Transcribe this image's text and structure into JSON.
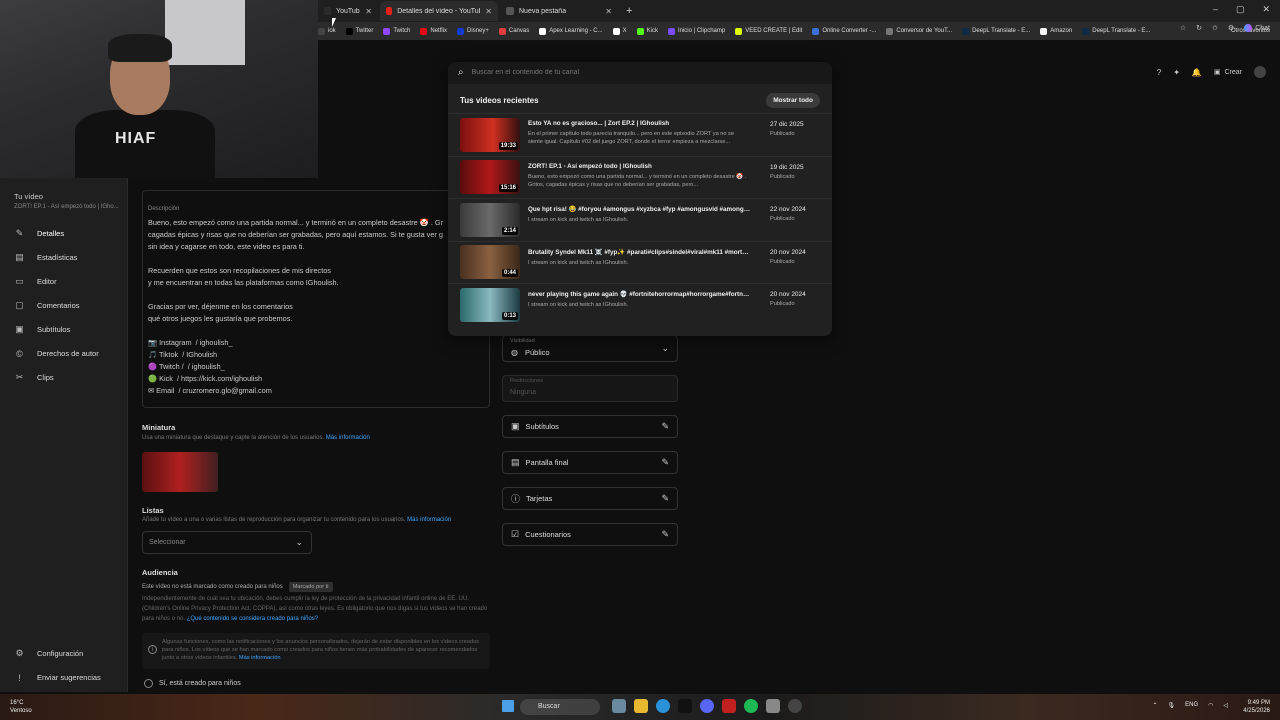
{
  "browser": {
    "tabs": [
      {
        "label": "YouTube",
        "favicon_color": "#2b2b2b"
      },
      {
        "label": "Detalles del vídeo - YouTube Studi",
        "favicon_color": "#e62117"
      },
      {
        "label": "Nueva pestaña",
        "favicon_color": "#555555"
      }
    ],
    "bookmarks": [
      "iok",
      "Twitter",
      "Twitch",
      "Netflix",
      "Disney+",
      "Canvas",
      "Apex Learning - C...",
      "X",
      "Kick",
      "Inicio | Clipchamp",
      "VEED CREATE | Edit",
      "Online Converter -...",
      "Conversor de YouT...",
      "DeepL Translate - E...",
      "Amazon",
      "DeepL Translate - E..."
    ],
    "other_bookmarks": "Otros favoritos",
    "chat_label": "Chat"
  },
  "webcam": {
    "shirt_text": "HIAF"
  },
  "topbar": {
    "create_label": "Crear"
  },
  "search": {
    "placeholder": "Buscar en el contenido de tu canal",
    "panel_title": "Tus videos recientes",
    "show_all": "Mostrar todo",
    "videos": [
      {
        "title": "Esto YA no es gracioso... | Zort EP.2 | IGhoulish",
        "desc": "En el primer capítulo todo parecía tranquilo... pero en este episodio ZORT ya no se siente igual. Capítulo #02 del juego ZORT, donde el terror empieza a mezclarse...",
        "duration": "19:33",
        "date": "27 dic 2025",
        "status": "Publicado",
        "thumb": "linear-gradient(90deg,#7a1010,#d03020 55%,#301010)"
      },
      {
        "title": "ZORT! EP.1 - Así empezó todo | IGhoulish",
        "desc": "Bueno, esto empezó como una partida normal... y terminó en un completo desastre 🤡 . Gritos, cagadas épicas y risas que no deberían ser grabadas, pero...",
        "duration": "15:16",
        "date": "19 dic 2025",
        "status": "Publicado",
        "thumb": "linear-gradient(90deg,#5a0c0c,#b01818 50%,#3a1212)"
      },
      {
        "title": "Que hpt risa! 😂 #foryou #amongus #xyzbca #fyp #amongusvid #amongust...",
        "desc": "I stream on kick and twitch as IGhoulish.",
        "duration": "2:14",
        "date": "22 nov 2024",
        "status": "Publicado",
        "thumb": "linear-gradient(90deg,#3a3a3a,#6a6a6a 50%,#2a2a2a)"
      },
      {
        "title": "Brutality Syndel Mk11 ☠️ #fyp✨ #parati#clips#sindel#viral#mk11 #mortalk...",
        "desc": "I stream on kick and twitch as IGhoulish.",
        "duration": "0:44",
        "date": "20 nov 2024",
        "status": "Publicado",
        "thumb": "linear-gradient(90deg,#4a3020,#8a6040 50%,#3a2818)"
      },
      {
        "title": "never playing this game again 💀 #fortnitehorrormap#horrorgame#fortnitec...",
        "desc": "I stream on kick and twitch as IGhoulish.",
        "duration": "0:13",
        "date": "20 nov 2024",
        "status": "Publicado",
        "thumb": "linear-gradient(90deg,#2a6a6a,#8ab8c0 50%,#1a3a40)"
      }
    ]
  },
  "sidebar": {
    "channel_title": "Tu vídeo",
    "channel_sub": "ZORT! EP.1 - Así empezó todo | IGho...",
    "items": [
      {
        "label": "Detalles",
        "icon": "✎"
      },
      {
        "label": "Estadísticas",
        "icon": "▤"
      },
      {
        "label": "Editor",
        "icon": "▭"
      },
      {
        "label": "Comentarios",
        "icon": "▢"
      },
      {
        "label": "Subtítulos",
        "icon": "▣"
      },
      {
        "label": "Derechos de autor",
        "icon": "©"
      },
      {
        "label": "Clips",
        "icon": "✂"
      }
    ],
    "settings": "Configuración",
    "feedback": "Enviar sugerencias"
  },
  "details": {
    "desc_label": "Descripción",
    "desc_lines": [
      "Bueno, esto empezó como una partida normal... y terminó en un completo desastre 🤡 . Gr",
      "cagadas épicas y risas que no deberían ser grabadas, pero aquí estamos. Si te gusta ver g",
      "sin idea y cagarse en todo, este video es para ti.",
      "",
      "Recuerden que estos son recopilaciones de mis directos",
      "y me encuentran en todas las plataformas como IGhoulish.",
      "",
      "Gracias por ver, déjenme en los comentarios",
      "qué otros juegos les gustaría que probemos.",
      "",
      "📷 Instagram  / ighoulish_",
      "🎵 Tiktok  / IGhoulish",
      "🟣 Twitch /  / ighoulish_",
      "🟢 Kick  / https://kick.com/ighoulish",
      "✉ Email  / cruzromero.glo@gmail.com"
    ],
    "thumb_title": "Miniatura",
    "thumb_sub": "Usa una miniatura que destaque y capte la atención de los usuarios.",
    "more_info": "Más información",
    "lists_title": "Listas",
    "lists_sub": "Añade tu vídeo a una o varias listas de reproducción para organizar tu contenido para los usuarios.",
    "select_label": "Seleccionar",
    "audience_title": "Audiencia",
    "audience_status": "Este vídeo no está marcado como creado para niños",
    "audience_badge": "Marcado por ti",
    "audience_text": "Independientemente de cuál sea tu ubicación, debes cumplir la ley de protección de la privacidad infantil online de EE. UU. (Children's Online Privacy Protection Act, COPPA), así como otras leyes. Es obligatorio que nos digas si tus vídeos se han creado para niños o no.",
    "audience_link": "¿Qué contenido se considera creado para niños?",
    "info_text": "Algunas funciones, como las notificaciones y los anuncios personalizados, dejarán de estar disponibles en los vídeos creados para niños. Los vídeos que se han marcado como creados para niños tienen más probabilidades de aparecer recomendados junto a otros vídeos infantiles.",
    "radio_label": "Sí, está creado para niños"
  },
  "right": {
    "visibility_label": "Visibilidad",
    "visibility_value": "Público",
    "restrictions_label": "Restricciones",
    "restrictions_value": "Ninguna",
    "options": [
      {
        "label": "Subtítulos",
        "icon": "▣"
      },
      {
        "label": "Pantalla final",
        "icon": "▤"
      },
      {
        "label": "Tarjetas",
        "icon": "ⓘ"
      },
      {
        "label": "Cuestionarios",
        "icon": "☑"
      }
    ]
  },
  "taskbar": {
    "temp": "16°C",
    "weather": "Ventoso",
    "search": "Buscar",
    "lang": "ENG",
    "time": "9:49 PM",
    "date": "4/25/2026"
  }
}
